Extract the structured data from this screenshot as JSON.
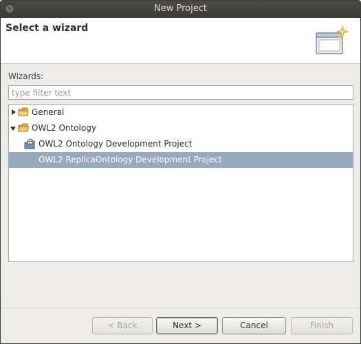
{
  "window": {
    "title": "New Project"
  },
  "header": {
    "title": "Select a wizard"
  },
  "filter": {
    "label": "Wizards:",
    "placeholder": "type filter text",
    "value": ""
  },
  "tree": {
    "items": [
      {
        "label": "General",
        "expanded": false,
        "level": 0,
        "type": "folder"
      },
      {
        "label": "OWL2 Ontology",
        "expanded": true,
        "level": 0,
        "type": "folder"
      },
      {
        "label": "OWL2 Ontology Development Project",
        "level": 1,
        "type": "project"
      },
      {
        "label": "OWL2 ReplicaOntology Development Project",
        "level": 1,
        "type": "project",
        "selected": true
      }
    ]
  },
  "buttons": {
    "back": "< Back",
    "next": "Next >",
    "cancel": "Cancel",
    "finish": "Finish"
  },
  "colors": {
    "titlebar": "#3c3b37",
    "selection": "#98a8be",
    "dialog_bg": "#edeceb"
  }
}
